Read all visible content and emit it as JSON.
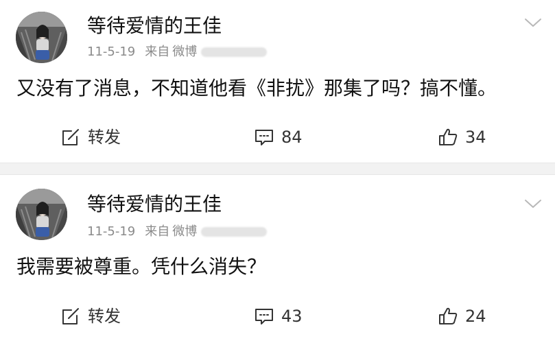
{
  "posts": [
    {
      "username": "等待爱情的王佳",
      "date": "11-5-19",
      "source_prefix": "来自",
      "source_app": "微博",
      "content": "又没有了消息，不知道他看《非扰》那集了吗？搞不懂。",
      "actions": {
        "repost_label": "转发",
        "comment_count": "84",
        "like_count": "34"
      }
    },
    {
      "username": "等待爱情的王佳",
      "date": "11-5-19",
      "source_prefix": "来自",
      "source_app": "微博",
      "content": "我需要被尊重。凭什么消失？",
      "actions": {
        "repost_label": "转发",
        "comment_count": "43",
        "like_count": "24"
      }
    }
  ],
  "icons": {
    "repost": "edit-square-icon",
    "comment": "comment-bubble-icon",
    "like": "thumbs-up-icon",
    "more": "chevron-down-icon"
  },
  "colors": {
    "text_primary": "#111111",
    "text_meta": "#8a8a8a",
    "divider": "#f2f2f2"
  }
}
